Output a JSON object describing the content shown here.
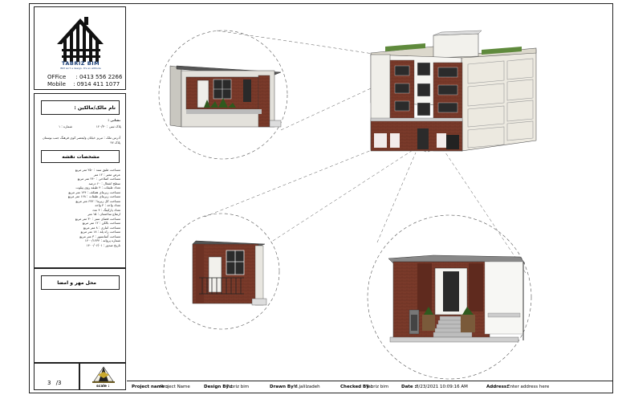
{
  "company": {
    "logo_text": "TABRIZ BIM",
    "logo_sub": "BIM isn't a design. It's an attitude",
    "office_label": "OFFice",
    "office_number": ": 0413 556 2266",
    "mobile_label": "Mobile",
    "mobile_number": ": 0914 411 1077"
  },
  "owner": {
    "title": "نام مالک/مالکین :"
  },
  "registration": {
    "line1_right": "پلاک ثبتی : ۱۲۰/۳۰",
    "line1_left": "شماره : ۱",
    "address": "آدرس ملک : تبریز خیابان ولیعصر کوی فرهنگ جنب بوستان",
    "address2": "پلاک ۲۷",
    "address_label": "نشانی :"
  },
  "specs": {
    "title": "مشخصات نقشه",
    "lines": [
      "مساحت طبق سند : ۲۵۰ متر مربع",
      "عرض معبر : ۱۲ متر",
      "مساحت اصلاحی : ۲۴۰ متر مربع",
      "سطح اشغال : ۶۰ درصد",
      "تعداد طبقات : ۴ طبقه روی پیلوت",
      "مساحت زیربنای همکف : ۱۴۴ متر مربع",
      "مساحت زیربنای طبقات : ۱۶۸ متر مربع",
      "مساحت کل زیربنا : ۶۷۲ متر مربع",
      "تعداد واحد : ۴ واحد",
      "تعداد پارکینگ : ۴ عدد",
      "ارتفاع ساختمان : ۱۵ متر",
      "مساحت فضای سبز : ۳۰ متر مربع",
      "مساحت بالکن : ۱۲ متر مربع",
      "مساحت انباری : ۸ متر مربع",
      "مساحت راه پله : ۱۸ متر مربع",
      "مساحت آسانسور : ۳ متر مربع",
      "شماره پروانه : ۱۴۰۰/۱۲۳۴",
      "تاریخ صدور : ۱۴۰۰/۰۶/۰۱"
    ]
  },
  "stamp": {
    "title": "محل مهر و امضا"
  },
  "sheet": {
    "number": "3",
    "total": "/3",
    "scale_label": "scale :"
  },
  "footer": {
    "project_label": "Project name :",
    "project_value": "Project Name",
    "design_label": "Design By :",
    "design_value": "Tabriz bim",
    "drawn_label": "Drawn By :",
    "drawn_value": "M.jalilzadeh",
    "checked_label": "Checked By :",
    "checked_value": "Tabriz bim",
    "date_label": "Date :",
    "date_value": "8/23/2021 10:09:16 AM",
    "address_label": "Address:",
    "address_value": "Enter address here"
  }
}
